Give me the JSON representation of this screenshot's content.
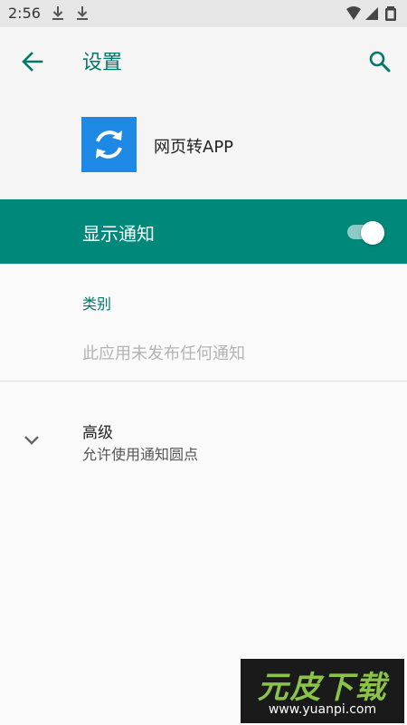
{
  "status_bar": {
    "time": "2:56",
    "icons": [
      "download-icon",
      "download-icon",
      "wifi-icon",
      "signal-icon",
      "battery-icon"
    ]
  },
  "app_bar": {
    "title": "设置",
    "back_icon": "arrow-back-icon",
    "search_icon": "search-icon"
  },
  "app_info": {
    "name": "网页转APP",
    "icon": "sync-icon",
    "icon_color": "#1e88e5"
  },
  "notifications": {
    "label": "显示通知",
    "enabled": true,
    "row_color": "#00897b"
  },
  "category": {
    "header": "类别",
    "empty_text": "此应用未发布任何通知"
  },
  "advanced": {
    "title": "高级",
    "summary": "允许使用通知圆点",
    "expand_icon": "chevron-down-icon"
  },
  "watermark": {
    "main": "元皮下载",
    "url": "www.yuanpi.com"
  },
  "colors": {
    "accent": "#00796b",
    "primary_row": "#00897b",
    "status_bar": "#e6e6e6",
    "background": "#fafafa"
  }
}
